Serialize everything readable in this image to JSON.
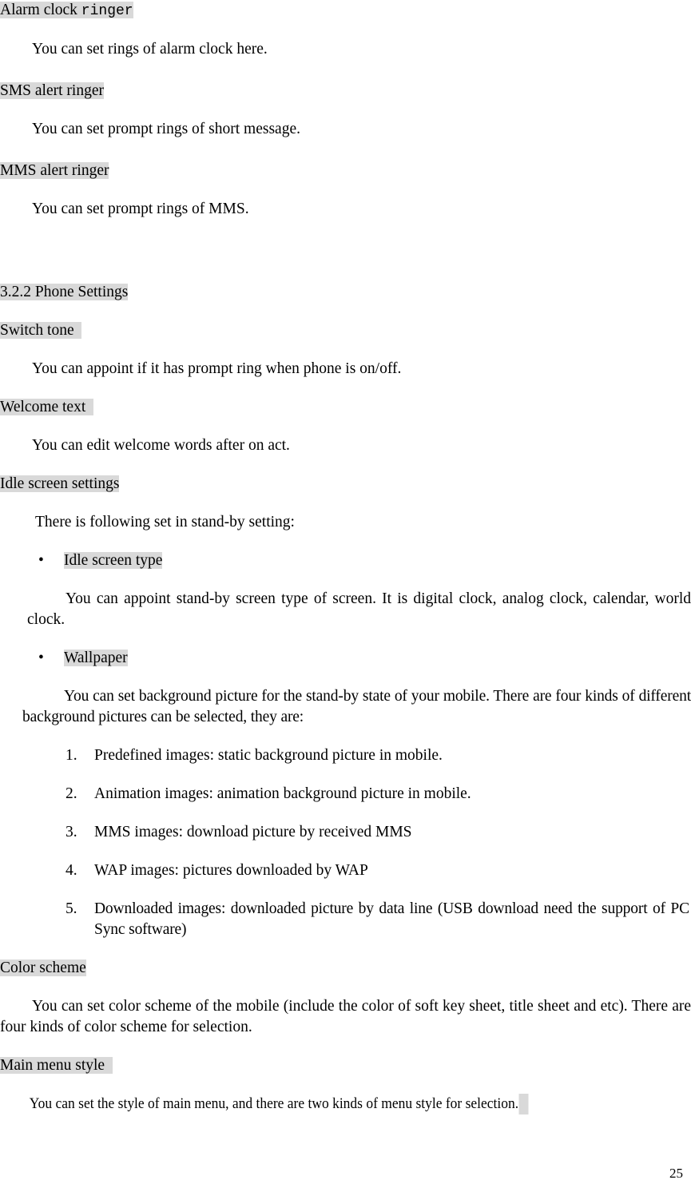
{
  "document": {
    "page_number": "25",
    "highlight_color": "#d9d9d9",
    "text_color": "#000000",
    "background_color": "#ffffff"
  },
  "sections": {
    "alarm_clock": {
      "heading_part1": "Alarm clock ",
      "heading_part2": "ringer",
      "body": "You can set rings of alarm clock here."
    },
    "sms_alert": {
      "heading": "SMS alert ringer",
      "body": "You can set prompt rings of short message."
    },
    "mms_alert": {
      "heading": "MMS alert ringer",
      "body": "You can set prompt rings of MMS."
    },
    "phone_settings": {
      "heading": "3.2.2 Phone Settings"
    },
    "switch_tone": {
      "heading": "Switch tone  ",
      "body": "You can appoint if it has prompt ring when phone is on/off."
    },
    "welcome_text": {
      "heading": "Welcome text  ",
      "body": "You can edit welcome words after on act."
    },
    "idle_screen_settings": {
      "heading": "Idle screen settings",
      "intro": "There is following set in stand-by setting:",
      "bullets": [
        {
          "label": "Idle screen type",
          "body": "You can appoint stand-by screen type of screen. It is digital clock, analog clock, calendar, world clock."
        },
        {
          "label": "Wallpaper",
          "body": "You can set background picture for the stand-by state of your mobile. There are four kinds of different background pictures can be selected, they are:"
        }
      ],
      "numbered_items": [
        {
          "number": "1.",
          "text": "Predefined images: static background picture in mobile."
        },
        {
          "number": "2.",
          "text": "Animation images: animation background picture in mobile."
        },
        {
          "number": "3.",
          "text": "MMS images: download picture by received MMS"
        },
        {
          "number": "4.",
          "text": "WAP images: pictures downloaded by WAP"
        },
        {
          "number": "5.",
          "text": "Downloaded images: downloaded picture by data line (USB download need the support of PC Sync software)"
        }
      ]
    },
    "color_scheme": {
      "heading": "Color scheme",
      "body": "You can set color scheme of the mobile (include the color of soft key sheet, title sheet and etc). There are four kinds of color scheme for selection."
    },
    "main_menu_style": {
      "heading": "Main menu style  ",
      "body": "You can set the style of main menu, and there are two kinds of menu style for selection."
    }
  }
}
